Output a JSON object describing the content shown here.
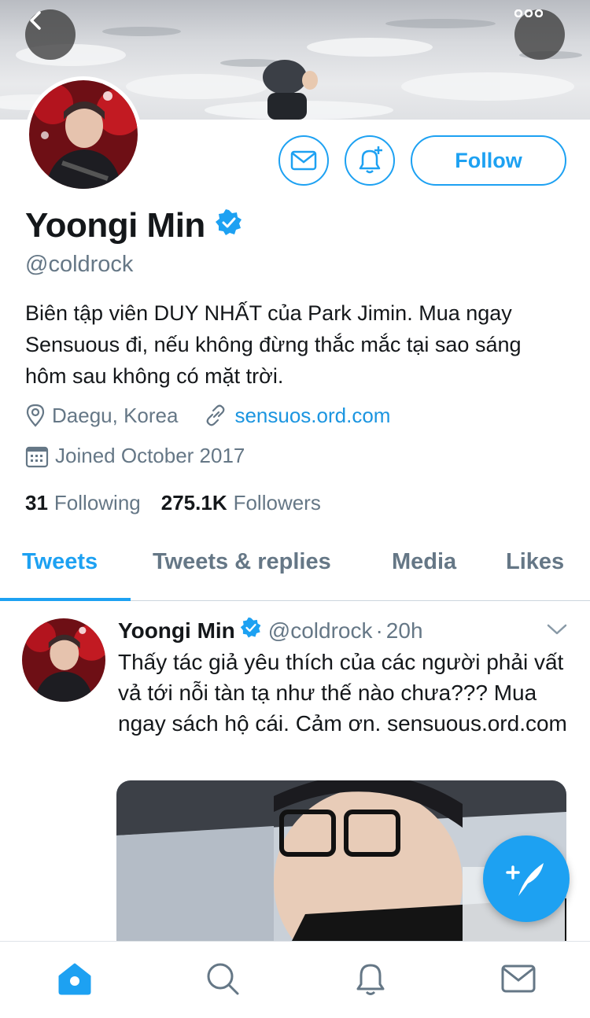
{
  "profile": {
    "name": "Yoongi Min",
    "handle": "@coldrock",
    "bio": "Biên tập viên DUY NHẤT của Park Jimin. Mua ngay Sensuous đi, nếu không đừng thắc mắc tại sao sáng hôm sau không có mặt trời.",
    "location": "Daegu, Korea",
    "website": "sensuos.ord.com",
    "joined": "Joined October 2017",
    "following_count": "31",
    "following_label": "Following",
    "followers_count": "275.1K",
    "followers_label": "Followers",
    "follow_button": "Follow",
    "verified": true
  },
  "tabs": [
    {
      "label": "Tweets",
      "active": true
    },
    {
      "label": "Tweets & replies",
      "active": false
    },
    {
      "label": "Media",
      "active": false
    },
    {
      "label": "Likes",
      "active": false
    }
  ],
  "tweet": {
    "name": "Yoongi Min",
    "handle": "@coldrock",
    "separator": "·",
    "time": "20h",
    "text": "Thấy tác giả yêu thích của các người phải vất vả tới nỗi tàn tạ như thế nào chưa??? Mua ngay sách hộ cái. Cảm ơn. sensuous.ord.com"
  },
  "icons": {
    "back": "chevron-left-icon",
    "more": "more-dots-icon",
    "mail": "mail-icon",
    "bell": "bell-plus-icon",
    "verified": "verified-badge-icon",
    "location": "location-pin-icon",
    "link": "link-icon",
    "calendar": "calendar-icon",
    "compose": "compose-tweet-icon",
    "nav": [
      "home-icon",
      "search-icon",
      "notifications-icon",
      "messages-icon"
    ]
  },
  "colors": {
    "accent": "#1da1f2",
    "muted": "#657786",
    "text": "#14171a"
  }
}
